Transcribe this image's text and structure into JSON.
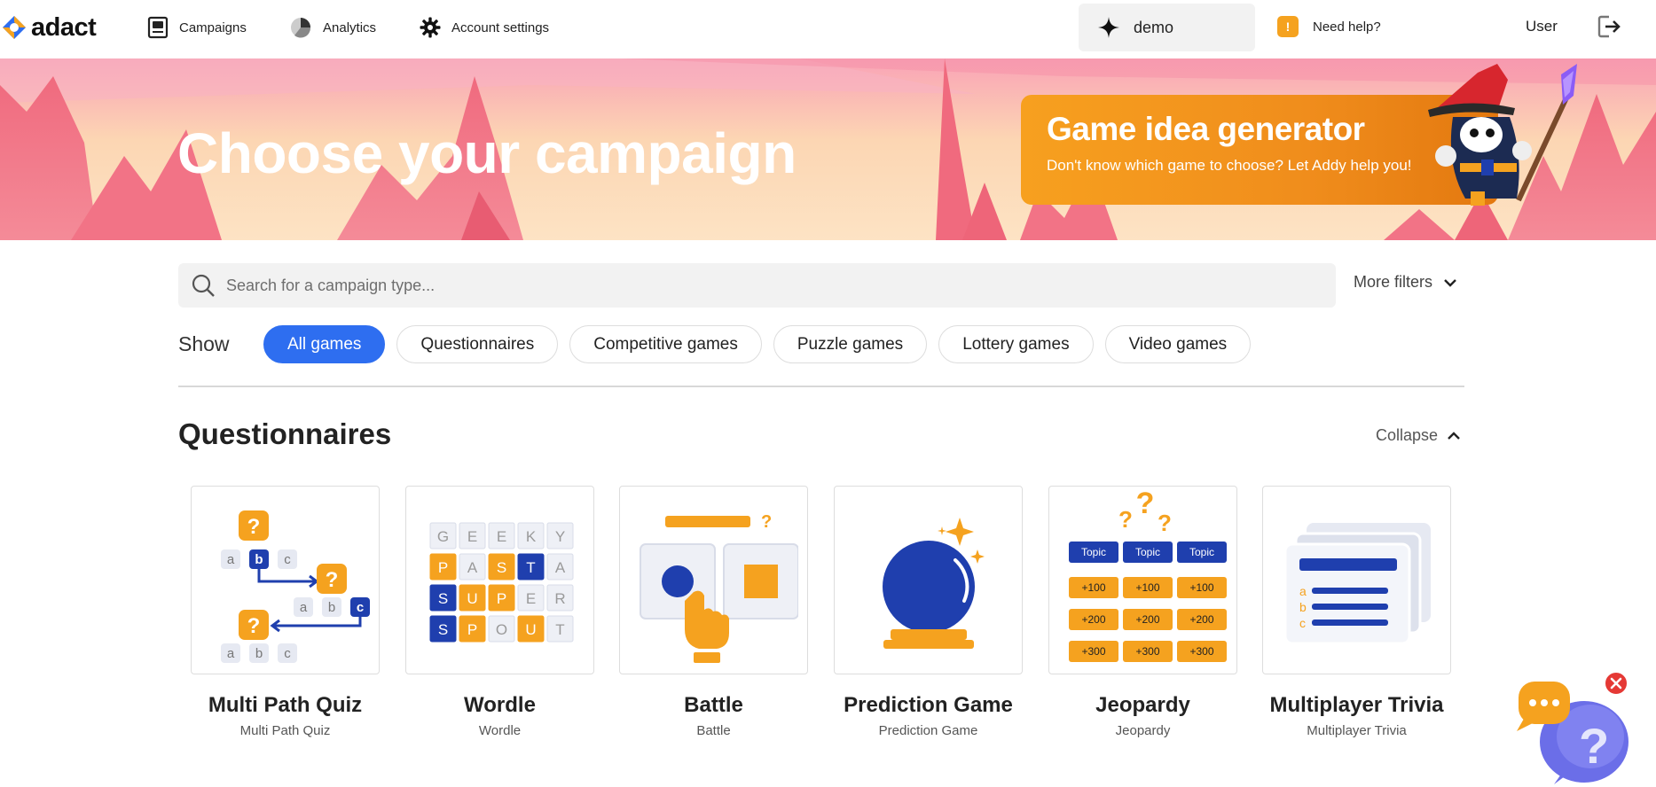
{
  "nav": {
    "logo_text": "adact",
    "items": [
      {
        "label": "Campaigns",
        "icon": "campaigns-icon"
      },
      {
        "label": "Analytics",
        "icon": "analytics-pie-icon"
      },
      {
        "label": "Account settings",
        "icon": "gear-icon"
      }
    ],
    "workspace": "demo",
    "help_label": "Need help?",
    "help_badge": "!",
    "user": "User"
  },
  "hero": {
    "title": "Choose your campaign",
    "generator_title": "Game idea generator",
    "generator_sub": "Don't know which game to choose? Let Addy help you!"
  },
  "search": {
    "placeholder": "Search for a campaign type...",
    "more_filters": "More filters"
  },
  "filters": {
    "show_label": "Show",
    "chips": [
      "All games",
      "Questionnaires",
      "Competitive games",
      "Puzzle games",
      "Lottery games",
      "Video games"
    ],
    "active": "All games"
  },
  "section": {
    "title": "Questionnaires",
    "collapse": "Collapse",
    "cards": [
      {
        "title": "Multi Path Quiz",
        "subtitle": "Multi Path Quiz"
      },
      {
        "title": "Wordle",
        "subtitle": "Wordle"
      },
      {
        "title": "Battle",
        "subtitle": "Battle"
      },
      {
        "title": "Prediction Game",
        "subtitle": "Prediction Game"
      },
      {
        "title": "Jeopardy",
        "subtitle": "Jeopardy"
      },
      {
        "title": "Multiplayer Trivia",
        "subtitle": "Multiplayer Trivia"
      }
    ],
    "thumbnails": {
      "multipath": {
        "rows": [
          [
            "a",
            "b",
            "c"
          ],
          [
            "a",
            "b",
            "c"
          ],
          [
            "a",
            "b",
            "c"
          ]
        ],
        "marker": "?"
      },
      "wordle": {
        "rows": [
          [
            "G",
            "E",
            "E",
            "K",
            "Y"
          ],
          [
            "P",
            "A",
            "S",
            "T",
            "A"
          ],
          [
            "S",
            "U",
            "P",
            "E",
            "R"
          ],
          [
            "S",
            "P",
            "O",
            "U",
            "T"
          ]
        ]
      },
      "jeopardy": {
        "topics": [
          "Topic",
          "Topic",
          "Topic"
        ],
        "values": [
          [
            "+100",
            "+100",
            "+100"
          ],
          [
            "+200",
            "+200",
            "+200"
          ],
          [
            "+300",
            "+300",
            "+300"
          ]
        ]
      },
      "trivia": {
        "letters": [
          "a",
          "b",
          "c"
        ]
      }
    }
  },
  "colors": {
    "accent": "#2e6ef0",
    "orange": "#f5a21f",
    "navy": "#1f3fae"
  }
}
